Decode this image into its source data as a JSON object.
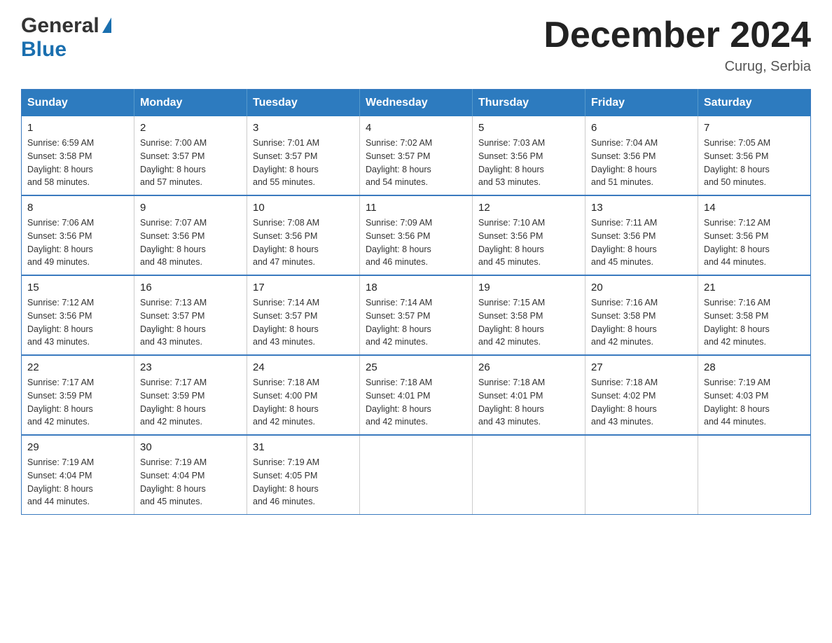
{
  "header": {
    "logo": {
      "general": "General",
      "blue": "Blue",
      "triangle_color": "#1a6faf"
    },
    "title": "December 2024",
    "subtitle": "Curug, Serbia"
  },
  "calendar": {
    "weekdays": [
      "Sunday",
      "Monday",
      "Tuesday",
      "Wednesday",
      "Thursday",
      "Friday",
      "Saturday"
    ],
    "weeks": [
      [
        {
          "day": "1",
          "sunrise": "6:59 AM",
          "sunset": "3:58 PM",
          "daylight": "8 hours and 58 minutes."
        },
        {
          "day": "2",
          "sunrise": "7:00 AM",
          "sunset": "3:57 PM",
          "daylight": "8 hours and 57 minutes."
        },
        {
          "day": "3",
          "sunrise": "7:01 AM",
          "sunset": "3:57 PM",
          "daylight": "8 hours and 55 minutes."
        },
        {
          "day": "4",
          "sunrise": "7:02 AM",
          "sunset": "3:57 PM",
          "daylight": "8 hours and 54 minutes."
        },
        {
          "day": "5",
          "sunrise": "7:03 AM",
          "sunset": "3:56 PM",
          "daylight": "8 hours and 53 minutes."
        },
        {
          "day": "6",
          "sunrise": "7:04 AM",
          "sunset": "3:56 PM",
          "daylight": "8 hours and 51 minutes."
        },
        {
          "day": "7",
          "sunrise": "7:05 AM",
          "sunset": "3:56 PM",
          "daylight": "8 hours and 50 minutes."
        }
      ],
      [
        {
          "day": "8",
          "sunrise": "7:06 AM",
          "sunset": "3:56 PM",
          "daylight": "8 hours and 49 minutes."
        },
        {
          "day": "9",
          "sunrise": "7:07 AM",
          "sunset": "3:56 PM",
          "daylight": "8 hours and 48 minutes."
        },
        {
          "day": "10",
          "sunrise": "7:08 AM",
          "sunset": "3:56 PM",
          "daylight": "8 hours and 47 minutes."
        },
        {
          "day": "11",
          "sunrise": "7:09 AM",
          "sunset": "3:56 PM",
          "daylight": "8 hours and 46 minutes."
        },
        {
          "day": "12",
          "sunrise": "7:10 AM",
          "sunset": "3:56 PM",
          "daylight": "8 hours and 45 minutes."
        },
        {
          "day": "13",
          "sunrise": "7:11 AM",
          "sunset": "3:56 PM",
          "daylight": "8 hours and 45 minutes."
        },
        {
          "day": "14",
          "sunrise": "7:12 AM",
          "sunset": "3:56 PM",
          "daylight": "8 hours and 44 minutes."
        }
      ],
      [
        {
          "day": "15",
          "sunrise": "7:12 AM",
          "sunset": "3:56 PM",
          "daylight": "8 hours and 43 minutes."
        },
        {
          "day": "16",
          "sunrise": "7:13 AM",
          "sunset": "3:57 PM",
          "daylight": "8 hours and 43 minutes."
        },
        {
          "day": "17",
          "sunrise": "7:14 AM",
          "sunset": "3:57 PM",
          "daylight": "8 hours and 43 minutes."
        },
        {
          "day": "18",
          "sunrise": "7:14 AM",
          "sunset": "3:57 PM",
          "daylight": "8 hours and 42 minutes."
        },
        {
          "day": "19",
          "sunrise": "7:15 AM",
          "sunset": "3:58 PM",
          "daylight": "8 hours and 42 minutes."
        },
        {
          "day": "20",
          "sunrise": "7:16 AM",
          "sunset": "3:58 PM",
          "daylight": "8 hours and 42 minutes."
        },
        {
          "day": "21",
          "sunrise": "7:16 AM",
          "sunset": "3:58 PM",
          "daylight": "8 hours and 42 minutes."
        }
      ],
      [
        {
          "day": "22",
          "sunrise": "7:17 AM",
          "sunset": "3:59 PM",
          "daylight": "8 hours and 42 minutes."
        },
        {
          "day": "23",
          "sunrise": "7:17 AM",
          "sunset": "3:59 PM",
          "daylight": "8 hours and 42 minutes."
        },
        {
          "day": "24",
          "sunrise": "7:18 AM",
          "sunset": "4:00 PM",
          "daylight": "8 hours and 42 minutes."
        },
        {
          "day": "25",
          "sunrise": "7:18 AM",
          "sunset": "4:01 PM",
          "daylight": "8 hours and 42 minutes."
        },
        {
          "day": "26",
          "sunrise": "7:18 AM",
          "sunset": "4:01 PM",
          "daylight": "8 hours and 43 minutes."
        },
        {
          "day": "27",
          "sunrise": "7:18 AM",
          "sunset": "4:02 PM",
          "daylight": "8 hours and 43 minutes."
        },
        {
          "day": "28",
          "sunrise": "7:19 AM",
          "sunset": "4:03 PM",
          "daylight": "8 hours and 44 minutes."
        }
      ],
      [
        {
          "day": "29",
          "sunrise": "7:19 AM",
          "sunset": "4:04 PM",
          "daylight": "8 hours and 44 minutes."
        },
        {
          "day": "30",
          "sunrise": "7:19 AM",
          "sunset": "4:04 PM",
          "daylight": "8 hours and 45 minutes."
        },
        {
          "day": "31",
          "sunrise": "7:19 AM",
          "sunset": "4:05 PM",
          "daylight": "8 hours and 46 minutes."
        },
        null,
        null,
        null,
        null
      ]
    ]
  }
}
